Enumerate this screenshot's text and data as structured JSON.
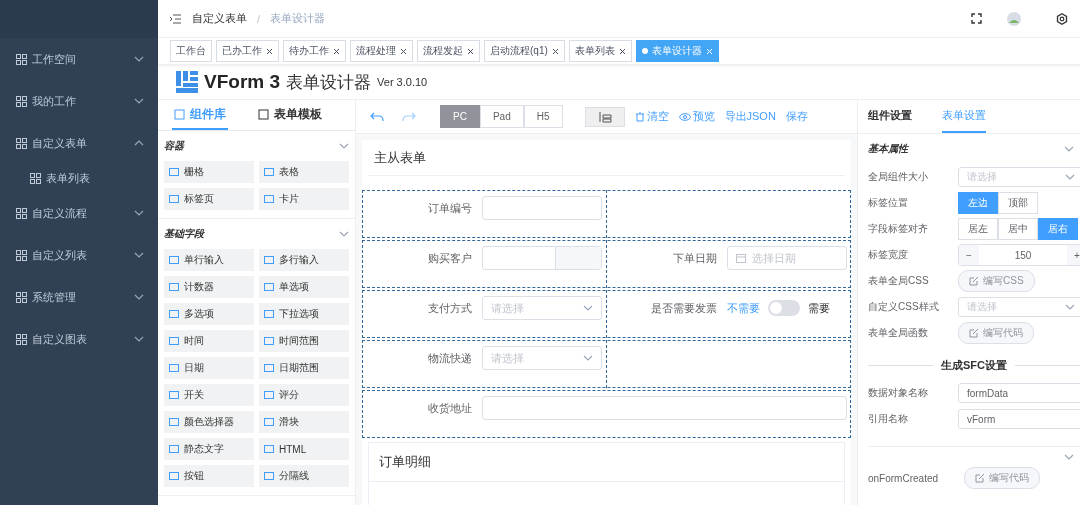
{
  "sidebar": {
    "items": [
      {
        "label": "工作空间",
        "expanded": false
      },
      {
        "label": "我的工作",
        "expanded": false
      },
      {
        "label": "自定义表单",
        "expanded": true,
        "children": [
          {
            "label": "表单列表"
          }
        ]
      },
      {
        "label": "自定义流程",
        "expanded": false
      },
      {
        "label": "自定义列表",
        "expanded": false
      },
      {
        "label": "系统管理",
        "expanded": false
      },
      {
        "label": "自定义图表",
        "expanded": false
      }
    ]
  },
  "breadcrumb": {
    "items": [
      "自定义表单",
      "表单设计器"
    ],
    "separator": "/"
  },
  "tags": [
    {
      "label": "工作台",
      "closable": false,
      "selected": false
    },
    {
      "label": "已办工作",
      "closable": true,
      "selected": false
    },
    {
      "label": "待办工作",
      "closable": true,
      "selected": false
    },
    {
      "label": "流程处理",
      "closable": true,
      "selected": false
    },
    {
      "label": "流程发起",
      "closable": true,
      "selected": false
    },
    {
      "label": "启动流程(q1)",
      "closable": true,
      "selected": false
    },
    {
      "label": "表单列表",
      "closable": true,
      "selected": false
    },
    {
      "label": "表单设计器",
      "closable": true,
      "selected": true
    }
  ],
  "designer": {
    "title": "VForm 3",
    "subtitle": "表单设计器",
    "version": "Ver 3.0.10"
  },
  "left_tabs": [
    {
      "label": "组件库",
      "selected": true
    },
    {
      "label": "表单模板",
      "selected": false
    }
  ],
  "widget_groups": [
    {
      "title": "容器",
      "items": [
        "栅格",
        "表格",
        "标签页",
        "卡片"
      ]
    },
    {
      "title": "基础字段",
      "items": [
        "单行输入",
        "多行输入",
        "计数器",
        "单选项",
        "多选项",
        "下拉选项",
        "时间",
        "时间范围",
        "日期",
        "日期范围",
        "开关",
        "评分",
        "颜色选择器",
        "滑块",
        "静态文字",
        "HTML",
        "按钮",
        "分隔线"
      ]
    }
  ],
  "toolbar": {
    "devices": [
      {
        "label": "PC",
        "selected": true
      },
      {
        "label": "Pad",
        "selected": false
      },
      {
        "label": "H5",
        "selected": false
      }
    ],
    "actions": [
      "清空",
      "预览",
      "导出JSON",
      "保存"
    ]
  },
  "form": {
    "title": "主从表单",
    "rows": [
      {
        "cells": [
          {
            "kind": "input",
            "label": "订单编号"
          },
          {
            "kind": "empty"
          }
        ]
      },
      {
        "cells": [
          {
            "kind": "input-addon",
            "label": "购买客户"
          },
          {
            "kind": "date",
            "label": "下单日期",
            "placeholder": "选择日期"
          }
        ]
      },
      {
        "cells": [
          {
            "kind": "select",
            "label": "支付方式",
            "placeholder": "请选择"
          },
          {
            "kind": "switch",
            "label": "是否需要发票",
            "inactive_text": "不需要",
            "active_text": "需要",
            "on": false
          }
        ]
      },
      {
        "cells": [
          {
            "kind": "select",
            "label": "物流快递",
            "placeholder": "请选择"
          },
          {
            "kind": "empty"
          }
        ]
      },
      {
        "cells": [
          {
            "kind": "input",
            "label": "收货地址"
          }
        ]
      }
    ],
    "subform": {
      "title": "订单明细"
    }
  },
  "settings": {
    "tabs": [
      {
        "label": "组件设置",
        "selected": false
      },
      {
        "label": "表单设置",
        "selected": true
      }
    ],
    "section": "基本属性",
    "props": [
      {
        "kind": "select",
        "label": "全局组件大小",
        "placeholder": "请选择"
      },
      {
        "kind": "radio",
        "label": "标签位置",
        "options": [
          {
            "label": "左边",
            "selected": true
          },
          {
            "label": "顶部",
            "selected": false
          }
        ]
      },
      {
        "kind": "radio",
        "label": "字段标签对齐",
        "options": [
          {
            "label": "居左",
            "selected": false
          },
          {
            "label": "居中",
            "selected": false
          },
          {
            "label": "居右",
            "selected": true
          }
        ]
      },
      {
        "kind": "number",
        "label": "标签宽度",
        "value": "150",
        "minus": "−",
        "plus": "+"
      },
      {
        "kind": "button",
        "label": "表单全局CSS",
        "button": "编写CSS"
      },
      {
        "kind": "select",
        "label": "自定义CSS样式",
        "placeholder": "请选择"
      },
      {
        "kind": "button",
        "label": "表单全局函数",
        "button": "编写代码"
      }
    ],
    "sfc_title": "生成SFC设置",
    "sfc_props": [
      {
        "kind": "input",
        "label": "数据对象名称",
        "value": "formData"
      },
      {
        "kind": "input",
        "label": "引用名称",
        "value": "vForm"
      }
    ],
    "events": [
      {
        "label": "onFormCreated",
        "button": "编写代码"
      }
    ]
  }
}
